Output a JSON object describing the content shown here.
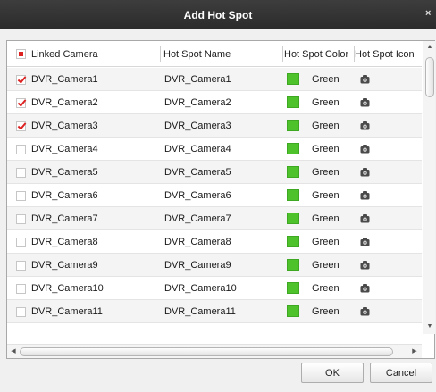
{
  "dialog": {
    "title": "Add Hot Spot",
    "close_glyph": "×"
  },
  "table": {
    "headers": {
      "linked_camera": "Linked Camera",
      "hot_spot_name": "Hot Spot Name",
      "hot_spot_color": "Hot Spot Color",
      "hot_spot_icon": "Hot Spot Icon"
    },
    "header_checkbox_state": "partial",
    "rows": [
      {
        "camera": "DVR_Camera1",
        "checked": true,
        "name": "DVR_Camera1",
        "color": "Green",
        "icon": "camera-icon"
      },
      {
        "camera": "DVR_Camera2",
        "checked": true,
        "name": "DVR_Camera2",
        "color": "Green",
        "icon": "camera-icon"
      },
      {
        "camera": "DVR_Camera3",
        "checked": true,
        "name": "DVR_Camera3",
        "color": "Green",
        "icon": "camera-icon"
      },
      {
        "camera": "DVR_Camera4",
        "checked": false,
        "name": "DVR_Camera4",
        "color": "Green",
        "icon": "camera-icon"
      },
      {
        "camera": "DVR_Camera5",
        "checked": false,
        "name": "DVR_Camera5",
        "color": "Green",
        "icon": "camera-icon"
      },
      {
        "camera": "DVR_Camera6",
        "checked": false,
        "name": "DVR_Camera6",
        "color": "Green",
        "icon": "camera-icon"
      },
      {
        "camera": "DVR_Camera7",
        "checked": false,
        "name": "DVR_Camera7",
        "color": "Green",
        "icon": "camera-icon"
      },
      {
        "camera": "DVR_Camera8",
        "checked": false,
        "name": "DVR_Camera8",
        "color": "Green",
        "icon": "camera-icon"
      },
      {
        "camera": "DVR_Camera9",
        "checked": false,
        "name": "DVR_Camera9",
        "color": "Green",
        "icon": "camera-icon"
      },
      {
        "camera": "DVR_Camera10",
        "checked": false,
        "name": "DVR_Camera10",
        "color": "Green",
        "icon": "camera-icon"
      },
      {
        "camera": "DVR_Camera11",
        "checked": false,
        "name": "DVR_Camera11",
        "color": "Green",
        "icon": "camera-icon"
      }
    ]
  },
  "colors": {
    "title_bar": "#333333",
    "green_swatch": "#4dc22a",
    "check_red": "#dd2222"
  },
  "buttons": {
    "ok": "OK",
    "cancel": "Cancel"
  }
}
